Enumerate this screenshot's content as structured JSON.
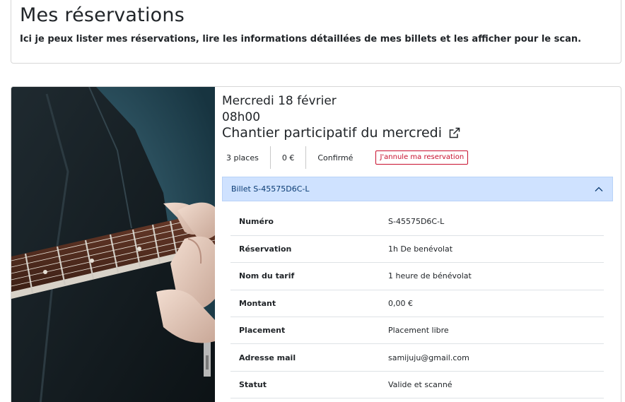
{
  "page": {
    "title": "Mes réservations",
    "subtitle": "Ici je peux lister mes réservations, lire les informations détaillées de mes billets et les afficher pour le scan."
  },
  "reservation": {
    "date": "Mercredi 18 février",
    "time": "08h00",
    "event_name": "Chantier participatif du mercredi",
    "places": "3 places",
    "price": "0 €",
    "status": "Confirmé",
    "cancel_label": "J'annule ma reservation"
  },
  "ticket": {
    "label": "Billet S-45575D6C-L",
    "rows": [
      {
        "key": "Numéro",
        "value": "S-45575D6C-L"
      },
      {
        "key": "Réservation",
        "value": "1h De benévolat"
      },
      {
        "key": "Nom du tarif",
        "value": "1 heure de bénévolat"
      },
      {
        "key": "Montant",
        "value": "0,00 €"
      },
      {
        "key": "Placement",
        "value": "Placement libre"
      },
      {
        "key": "Adresse mail",
        "value": "samijuju@gmail.com"
      },
      {
        "key": "Statut",
        "value": "Valide et scanné"
      }
    ]
  },
  "icons": [
    "external-link-icon",
    "chevron-up-icon"
  ],
  "colors": {
    "accordion_bg": "#cfe2ff",
    "cancel": "#c8102e"
  }
}
